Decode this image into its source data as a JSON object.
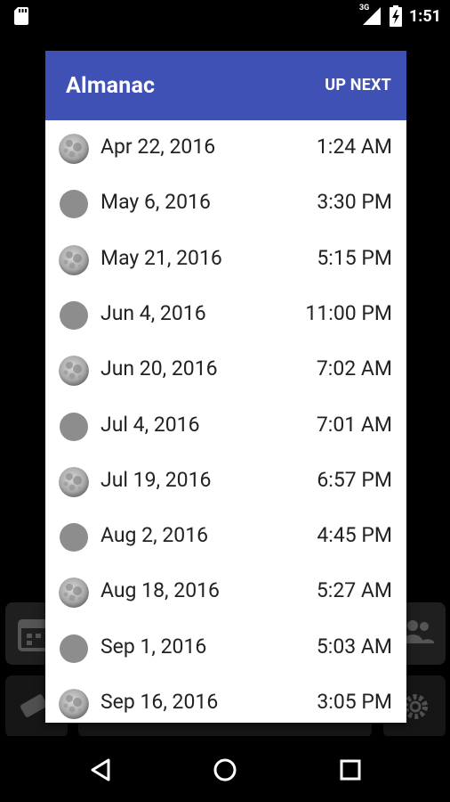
{
  "status_bar": {
    "time": "1:51",
    "network": "3G",
    "icons": [
      "sd-card-icon",
      "signal-icon",
      "battery-icon"
    ]
  },
  "dialog": {
    "title": "Almanac",
    "action_label": "UP NEXT",
    "header_color": "#3f51b5"
  },
  "events": [
    {
      "phase": "full-moon",
      "date": "Apr 22, 2016",
      "time": "1:24 AM"
    },
    {
      "phase": "new-moon",
      "date": "May 6, 2016",
      "time": "3:30 PM"
    },
    {
      "phase": "full-moon",
      "date": "May 21, 2016",
      "time": "5:15 PM"
    },
    {
      "phase": "new-moon",
      "date": "Jun 4, 2016",
      "time": "11:00 PM"
    },
    {
      "phase": "full-moon",
      "date": "Jun 20, 2016",
      "time": "7:02 AM"
    },
    {
      "phase": "new-moon",
      "date": "Jul 4, 2016",
      "time": "7:01 AM"
    },
    {
      "phase": "full-moon",
      "date": "Jul 19, 2016",
      "time": "6:57 PM"
    },
    {
      "phase": "new-moon",
      "date": "Aug 2, 2016",
      "time": "4:45 PM"
    },
    {
      "phase": "full-moon",
      "date": "Aug 18, 2016",
      "time": "5:27 AM"
    },
    {
      "phase": "new-moon",
      "date": "Sep 1, 2016",
      "time": "5:03 AM"
    },
    {
      "phase": "full-moon",
      "date": "Sep 16, 2016",
      "time": "3:05 PM"
    }
  ],
  "nav": {
    "icons": [
      "back-icon",
      "home-icon",
      "recents-icon"
    ]
  }
}
